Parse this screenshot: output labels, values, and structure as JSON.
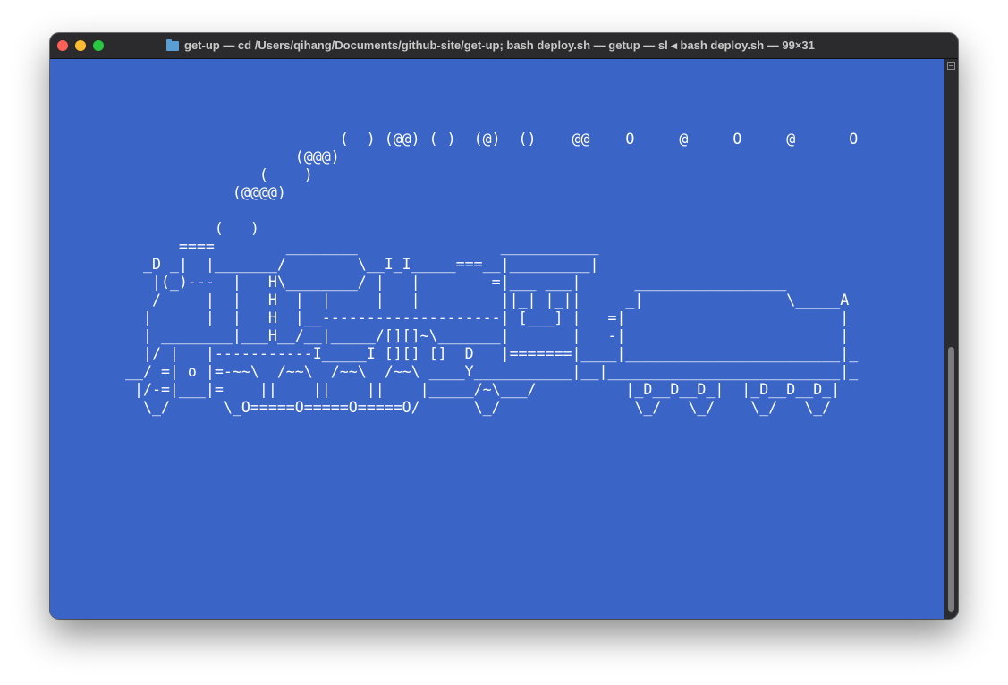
{
  "window": {
    "title": "get-up — cd /Users/qihang/Documents/github-site/get-up; bash deploy.sh — getup — sl ◂ bash deploy.sh — 99×31",
    "folder_icon": "folder-icon",
    "traffic_lights": {
      "close": "#fe5f57",
      "minimize": "#febc2e",
      "zoom": "#28c840"
    }
  },
  "terminal": {
    "background": "#3a65c6",
    "foreground": "#ffffff",
    "ascii_art": "                          (  ) (@@) ( )  (@)  ()    @@    O     @     O     @      O\n                     (@@@)\n                 (    )\n              (@@@@)\n\n            (   )\n        ====        ________                ___________\n    _D _|  |_______/        \\__I_I_____===__|_________|\n     |(_)---  |   H\\________/ |   |        =|___ ___|      _________________\n     /     |  |   H  |  |     |   |         ||_| |_||     _|                \\_____A\n    |      |  |   H  |__--------------------| [___] |   =|                        |\n    | ________|___H__/__|_____/[][]~\\_______|       |   -|                        |\n    |/ |   |-----------I_____I [][] []  D   |=======|____|________________________|_\n  __/ =| o |=-~~\\  /~~\\  /~~\\  /~~\\ ____Y___________|__|__________________________|_\n   |/-=|___|=    ||    ||    ||    |_____/~\\___/          |_D__D__D_|  |_D__D__D_|\n    \\_/      \\_O=====O=====O=====O/      \\_/               \\_/   \\_/    \\_/   \\_/"
  },
  "scrollbar": {
    "thumb_fraction_start": 0.51,
    "thumb_fraction_size": 0.47
  }
}
